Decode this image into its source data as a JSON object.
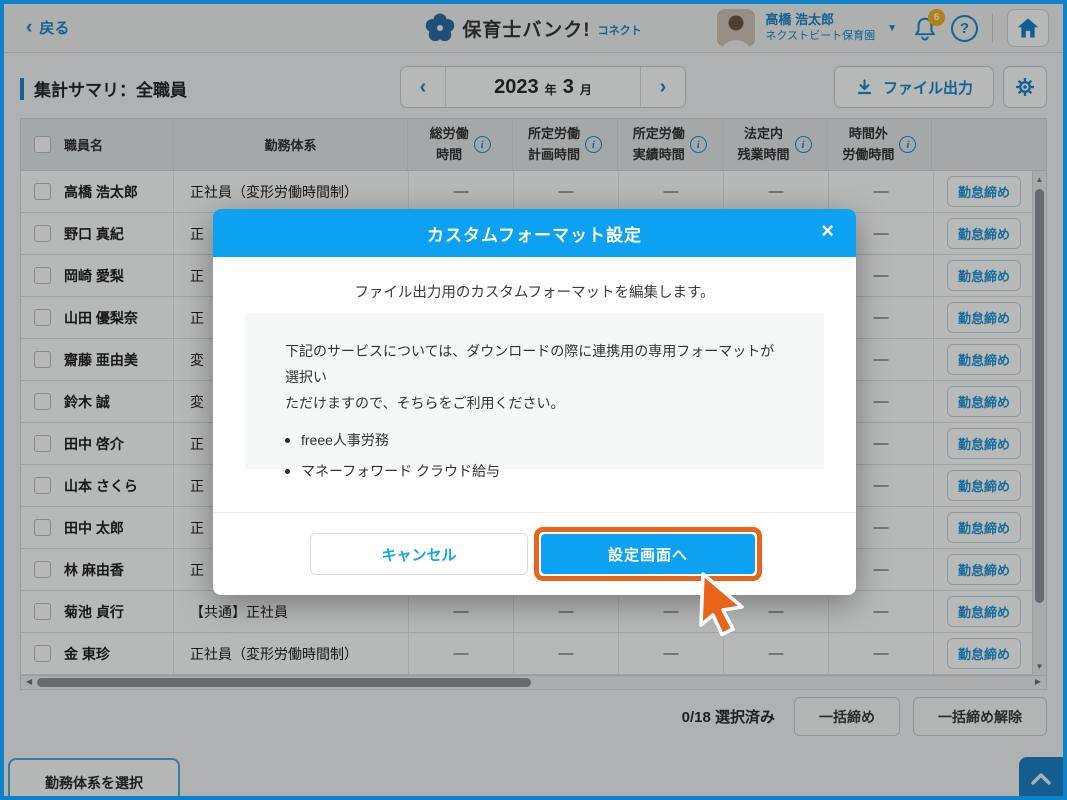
{
  "colors": {
    "accent_blue": "#1b87c9",
    "bright_blue": "#0da1f2",
    "highlight_orange": "#e8641a",
    "badge_yellow": "#f2b41f"
  },
  "chrome": {
    "back_label": "戻る",
    "app_title": "保育士バンク!",
    "app_subtitle": "コネクト",
    "user": {
      "name": "高橋 浩太郎",
      "org": "ネクストビート保育園",
      "notification_count": "6"
    }
  },
  "toolbar": {
    "page_title": "集計サマリ：全職員",
    "month": {
      "year": "2023",
      "year_unit": "年",
      "month": "3",
      "month_unit": "月"
    },
    "export_label": "ファイル出力"
  },
  "table": {
    "headers": {
      "name": "職員名",
      "worktype": "勤務体系",
      "metric_cols": [
        "総労働\n時間",
        "所定労働\n計画時間",
        "所定労働\n実績時間",
        "法定内\n残業時間",
        "時間外\n労働時間"
      ]
    },
    "dash": "—",
    "close_button_label": "勤怠締め",
    "rows": [
      {
        "name": "高橋 浩太郎",
        "worktype": "正社員（変形労働時間制）"
      },
      {
        "name": "野口 真紀",
        "worktype": "正"
      },
      {
        "name": "岡崎 愛梨",
        "worktype": "正"
      },
      {
        "name": "山田 優梨奈",
        "worktype": "正"
      },
      {
        "name": "齋藤 亜由美",
        "worktype": "変"
      },
      {
        "name": "鈴木 誠",
        "worktype": "変"
      },
      {
        "name": "田中 啓介",
        "worktype": "正"
      },
      {
        "name": "山本 さくら",
        "worktype": "正"
      },
      {
        "name": "田中 太郎",
        "worktype": "正"
      },
      {
        "name": "林 麻由香",
        "worktype": "正"
      },
      {
        "name": "菊池 貞行",
        "worktype": "【共通】正社員"
      },
      {
        "name": "金 東珍",
        "worktype": "正社員（変形労働時間制）"
      }
    ]
  },
  "footer": {
    "selected_summary": "0/18 選択済み",
    "bulk_close": "一括締め",
    "bulk_unclose": "一括締め解除",
    "select_worktype": "勤務体系を選択"
  },
  "modal": {
    "title": "カスタムフォーマット設定",
    "close": "×",
    "lead": "ファイル出力用のカスタムフォーマットを編集します。",
    "note": "下記のサービスについては、ダウンロードの際に連携用の専用フォーマットが選択い\nただけますので、そちらをご利用ください。",
    "bullets": [
      "freee人事労務",
      "マネーフォワード クラウド給与"
    ],
    "cancel": "キャンセル",
    "confirm": "設定画面へ"
  }
}
